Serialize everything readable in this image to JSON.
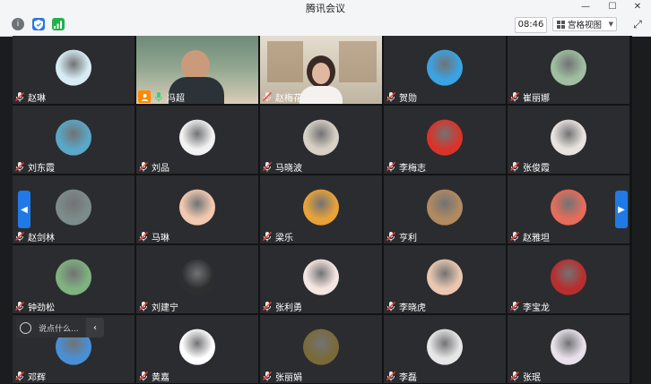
{
  "window": {
    "title": "腾讯会议"
  },
  "toolbar": {
    "time": "08:46",
    "view_label": "宫格视图"
  },
  "colors": {
    "accent": "#1f7ae8",
    "tile_bg": "#2b2c2f",
    "active_speaker_border": "#1fbd6a"
  },
  "chat": {
    "placeholder": "说点什么..."
  },
  "participants": [
    {
      "name": "赵琳",
      "avatar": "anime-boy-avatar",
      "color": "#d7ecf4"
    },
    {
      "name": "冯超",
      "avatar": "camera-video",
      "color": "#6f8a7a"
    },
    {
      "name": "赵梅花",
      "avatar": "camera-video",
      "color": "#d8d2c6"
    },
    {
      "name": "贺勋",
      "avatar": "doraemon-avatar",
      "color": "#3aa3e3"
    },
    {
      "name": "崔丽娜",
      "avatar": "landscape-avatar",
      "color": "#9fbfa0"
    },
    {
      "name": "刘东霞",
      "avatar": "beach-avatar",
      "color": "#5aa7c8"
    },
    {
      "name": "刘品",
      "avatar": "white-avatar",
      "color": "#f2f2f2"
    },
    {
      "name": "马晓波",
      "avatar": "sketch-avatar",
      "color": "#d8d0c4"
    },
    {
      "name": "李梅志",
      "avatar": "red-pattern-avatar",
      "color": "#d8342a"
    },
    {
      "name": "张俊霞",
      "avatar": "girl-photo-avatar",
      "color": "#e9e3df"
    },
    {
      "name": "赵剑林",
      "avatar": "lake-avatar",
      "color": "#7d8b8c"
    },
    {
      "name": "马琳",
      "avatar": "teddy-bear-avatar",
      "color": "#f1c9b0"
    },
    {
      "name": "梁乐",
      "avatar": "cartoon-kid-avatar",
      "color": "#e8a23a"
    },
    {
      "name": "亨利",
      "avatar": "kids-avatar",
      "color": "#b08a60"
    },
    {
      "name": "赵雅坦",
      "avatar": "mushroom-avatar",
      "color": "#e46c5b"
    },
    {
      "name": "钟劲松",
      "avatar": "field-avatar",
      "color": "#7fb27f"
    },
    {
      "name": "刘建宁",
      "avatar": "lamp-avatar",
      "color": "#2d2e30"
    },
    {
      "name": "张利勇",
      "avatar": "girl-cartoon-avatar",
      "color": "#f5e6e2"
    },
    {
      "name": "李晓虎",
      "avatar": "flower-avatar",
      "color": "#e9c7b0"
    },
    {
      "name": "李宝龙",
      "avatar": "car-avatar",
      "color": "#b82e2e"
    },
    {
      "name": "邓辉",
      "avatar": "sky-avatar",
      "color": "#4a8fd4"
    },
    {
      "name": "黄嘉",
      "avatar": "black-cat-avatar",
      "color": "#ffffff"
    },
    {
      "name": "张丽娟",
      "avatar": "forest-avatar",
      "color": "#7a6a3a"
    },
    {
      "name": "李磊",
      "avatar": "black-cat-photo-avatar",
      "color": "#e6e6e6"
    },
    {
      "name": "张珉",
      "avatar": "anime-girl-avatar",
      "color": "#e8e0ea"
    }
  ]
}
